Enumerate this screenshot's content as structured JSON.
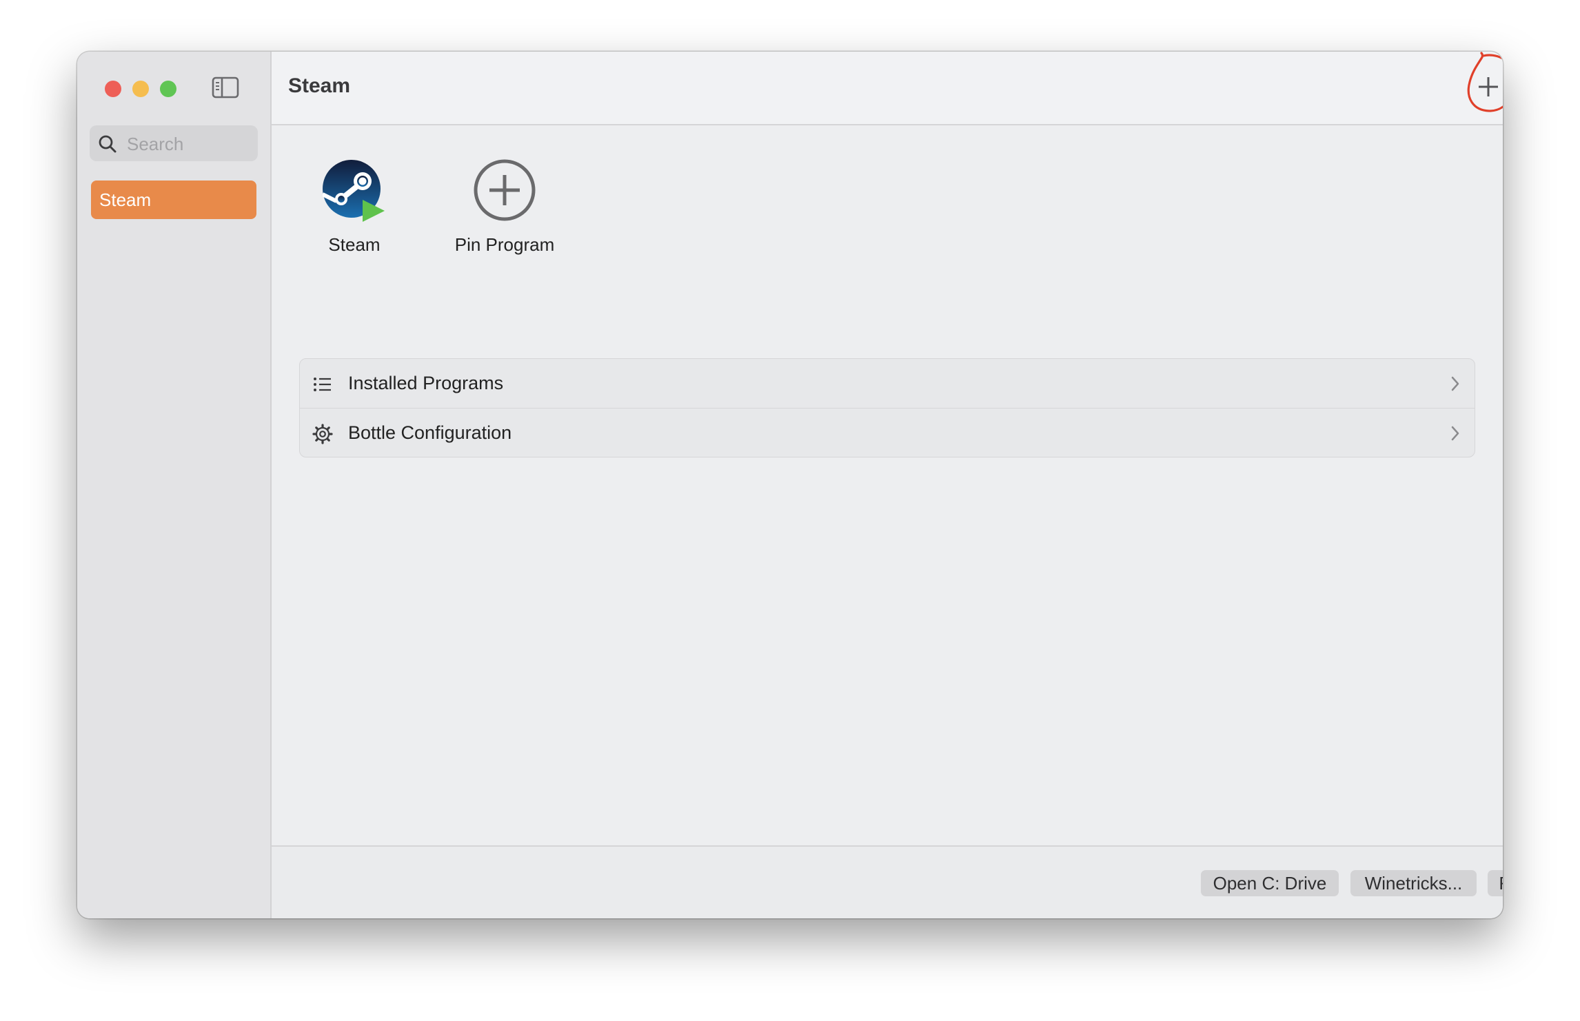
{
  "window": {
    "title": "Steam"
  },
  "sidebar": {
    "search": {
      "placeholder": "Search",
      "value": ""
    },
    "items": [
      {
        "label": "Steam",
        "selected": true
      }
    ]
  },
  "toolbar": {
    "add_icon": "plus-icon",
    "refresh_icon": "refresh-icon"
  },
  "pinned": [
    {
      "label": "Steam",
      "icon": "steam-icon"
    },
    {
      "label": "Pin Program",
      "icon": "plus-circle-icon"
    }
  ],
  "list": [
    {
      "label": "Installed Programs",
      "icon": "list-icon"
    },
    {
      "label": "Bottle Configuration",
      "icon": "gear-icon"
    }
  ],
  "footer": {
    "open_c_drive": "Open C: Drive",
    "winetricks": "Winetricks...",
    "run": "Run..."
  },
  "colors": {
    "accent": "#e88a4a",
    "annotation": "#e0402a",
    "traffic_red": "#ee5f57",
    "traffic_yellow": "#f5bd4f",
    "traffic_green": "#60c554"
  }
}
